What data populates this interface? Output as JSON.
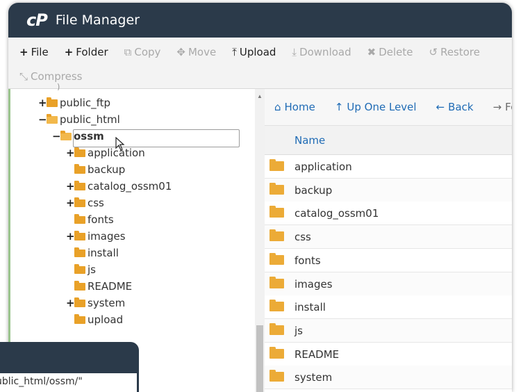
{
  "app": {
    "logo": "cP",
    "title": "File Manager"
  },
  "toolbar": {
    "row1": [
      {
        "icon": "plus-icon",
        "glyph": "+",
        "label": "File",
        "enabled": true
      },
      {
        "icon": "plus-icon",
        "glyph": "+",
        "label": "Folder",
        "enabled": true
      },
      {
        "icon": "copy-icon",
        "glyph": "⧉",
        "label": "Copy",
        "enabled": false
      },
      {
        "icon": "move-icon",
        "glyph": "✥",
        "label": "Move",
        "enabled": false
      },
      {
        "icon": "upload-icon",
        "glyph": "⤒",
        "label": "Upload",
        "enabled": true
      },
      {
        "icon": "download-icon",
        "glyph": "⤓",
        "label": "Download",
        "enabled": false
      },
      {
        "icon": "delete-icon",
        "glyph": "✖",
        "label": "Delete",
        "enabled": false
      },
      {
        "icon": "restore-icon",
        "glyph": "↺",
        "label": "Restore",
        "enabled": false
      }
    ],
    "row2": [
      {
        "icon": "compress-icon",
        "glyph": "⤡",
        "label": "Compress",
        "enabled": false
      }
    ]
  },
  "tree": {
    "items": [
      {
        "label": "public_ftp",
        "toggle": "+",
        "open": false
      },
      {
        "label": "public_html",
        "toggle": "−",
        "open": true
      },
      {
        "label": "ossm",
        "toggle": "−",
        "open": true,
        "selected": true
      },
      {
        "label": "application",
        "toggle": "+",
        "open": false
      },
      {
        "label": "backup",
        "toggle": "",
        "open": false
      },
      {
        "label": "catalog_ossm01",
        "toggle": "+",
        "open": false
      },
      {
        "label": "css",
        "toggle": "+",
        "open": false
      },
      {
        "label": "fonts",
        "toggle": "",
        "open": false
      },
      {
        "label": "images",
        "toggle": "+",
        "open": false
      },
      {
        "label": "install",
        "toggle": "",
        "open": false
      },
      {
        "label": "js",
        "toggle": "",
        "open": false
      },
      {
        "label": "README",
        "toggle": "",
        "open": false
      },
      {
        "label": "system",
        "toggle": "+",
        "open": false
      },
      {
        "label": "upload",
        "toggle": "",
        "open": false
      }
    ]
  },
  "nav": {
    "home": "Home",
    "up": "Up One Level",
    "back": "Back",
    "forward": "Fo"
  },
  "list": {
    "column_name": "Name",
    "rows": [
      "application",
      "backup",
      "catalog_ossm01",
      "css",
      "fonts",
      "images",
      "install",
      "js",
      "README",
      "system"
    ]
  },
  "popup": {
    "text": "ublic_html/ossm/\""
  },
  "colors": {
    "header_bg": "#2b3a4a",
    "folder": "#e9a128",
    "link": "#1f6bb5",
    "tree_border": "#9ac48d"
  }
}
